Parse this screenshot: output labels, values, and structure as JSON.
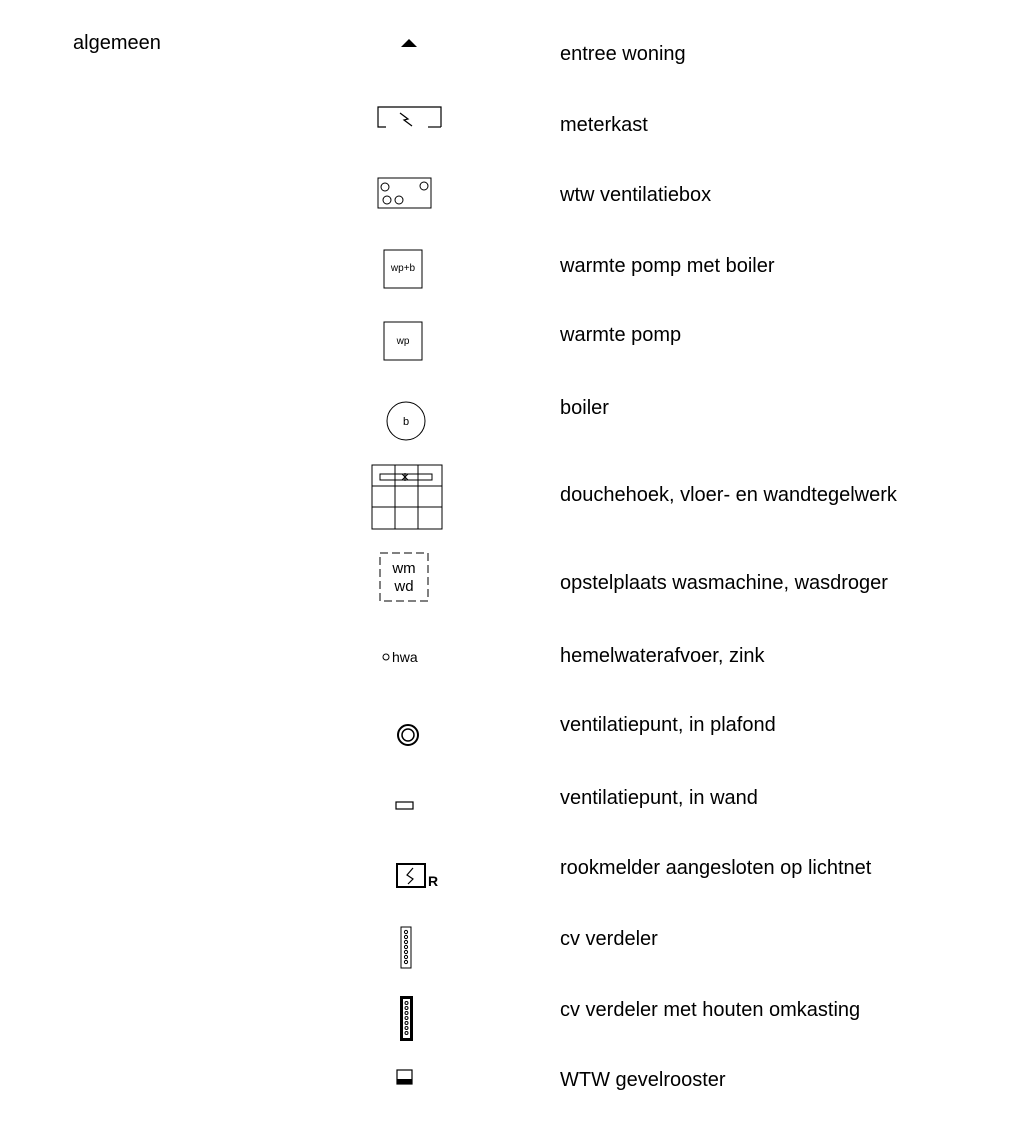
{
  "category": "algemeen",
  "symbols": {
    "warmte_pomp_boiler_text": "wp+b",
    "warmte_pomp_text": "wp",
    "boiler_text": "b",
    "wm_text": "wm",
    "wd_text": "wd",
    "hwa_text": "hwa",
    "rookmelder_text": "R"
  },
  "legend": [
    {
      "icon": "triangle-icon",
      "label": "entree woning"
    },
    {
      "icon": "meter-cupboard-icon",
      "label": "meterkast"
    },
    {
      "icon": "ventilation-box-icon",
      "label": "wtw ventilatiebox"
    },
    {
      "icon": "heat-pump-boiler-icon",
      "label": "warmte pomp met boiler"
    },
    {
      "icon": "heat-pump-icon",
      "label": "warmte pomp"
    },
    {
      "icon": "boiler-icon",
      "label": "boiler"
    },
    {
      "icon": "shower-tiles-icon",
      "label": "douchehoek, vloer- en wandtegelwerk"
    },
    {
      "icon": "washing-machine-spot-icon",
      "label": "opstelplaats wasmachine, wasdroger"
    },
    {
      "icon": "rainwater-drain-icon",
      "label": "hemelwaterafvoer, zink"
    },
    {
      "icon": "ceiling-vent-icon",
      "label": "ventilatiepunt, in plafond"
    },
    {
      "icon": "wall-vent-icon",
      "label": "ventilatiepunt, in wand"
    },
    {
      "icon": "smoke-detector-icon",
      "label": "rookmelder aangesloten op lichtnet"
    },
    {
      "icon": "cv-manifold-icon",
      "label": "cv verdeler"
    },
    {
      "icon": "cv-manifold-boxed-icon",
      "label": "cv verdeler met houten omkasting"
    },
    {
      "icon": "facade-grille-icon",
      "label": "WTW gevelrooster"
    }
  ]
}
